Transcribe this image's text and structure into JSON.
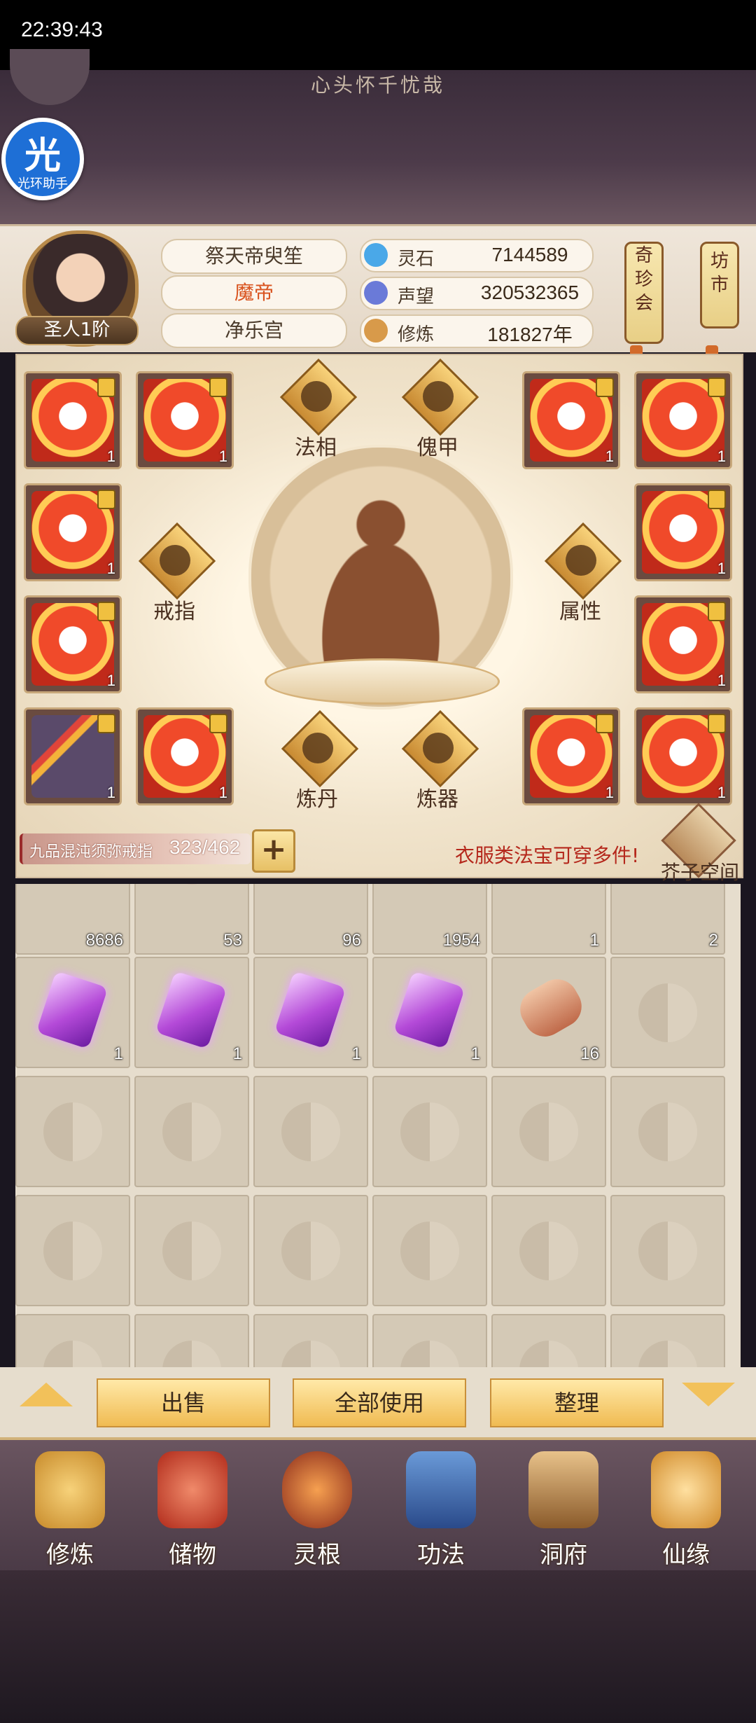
{
  "status": {
    "time": "22:39:43"
  },
  "top": {
    "subtitle": "心头怀千忧哉",
    "helper_big": "光",
    "helper_small": "光环助手"
  },
  "profile": {
    "rank": "圣人1阶",
    "name": "祭天帝臾笙",
    "title": "魔帝",
    "sect": "净乐宫",
    "stats": [
      {
        "label": "灵石",
        "value": "7144589",
        "color": "#4aa8e8"
      },
      {
        "label": "声望",
        "value": "320532365",
        "color": "#6a7ad8"
      },
      {
        "label": "修炼",
        "value": "181827年",
        "color": "#d89a4a"
      }
    ],
    "scrolls": [
      [
        "奇",
        "珍",
        "会"
      ],
      [
        "坊",
        "市"
      ]
    ]
  },
  "equipment": {
    "tabs": {
      "faxiang": "法相",
      "kuilei": "傀甲",
      "jiezhi": "戒指",
      "shuxing": "属性",
      "liandan": "炼丹",
      "lianqi": "炼器"
    },
    "slots": [
      {
        "count": "1"
      },
      {
        "count": "1"
      },
      {
        "count": "1"
      },
      {
        "count": "1"
      },
      {
        "count": "1"
      },
      {
        "count": "1"
      },
      {
        "count": "1"
      },
      {
        "count": "1"
      },
      {
        "count": "1"
      },
      {
        "count": "1"
      },
      {
        "count": "1"
      },
      {
        "count": "1"
      }
    ]
  },
  "ring": {
    "name": "九品混沌须弥戒指",
    "capacity": "323/462",
    "plus": "+",
    "tip": "衣服类法宝可穿多件!",
    "space_label": "芥子空间"
  },
  "inventory": {
    "row0": [
      "8686",
      "53",
      "96",
      "1954",
      "1",
      "2"
    ],
    "row1": [
      "1",
      "1",
      "1",
      "1",
      "16"
    ]
  },
  "actions": {
    "sell": "出售",
    "use_all": "全部使用",
    "sort": "整理"
  },
  "nav": [
    {
      "label": "修炼",
      "color": "#d9a441"
    },
    {
      "label": "储物",
      "color": "#c8442e"
    },
    {
      "label": "灵根",
      "color": "#b0472a"
    },
    {
      "label": "功法",
      "color": "#3a6ab0"
    },
    {
      "label": "洞府",
      "color": "#b07a3a"
    },
    {
      "label": "仙缘",
      "color": "#e0a040"
    }
  ]
}
